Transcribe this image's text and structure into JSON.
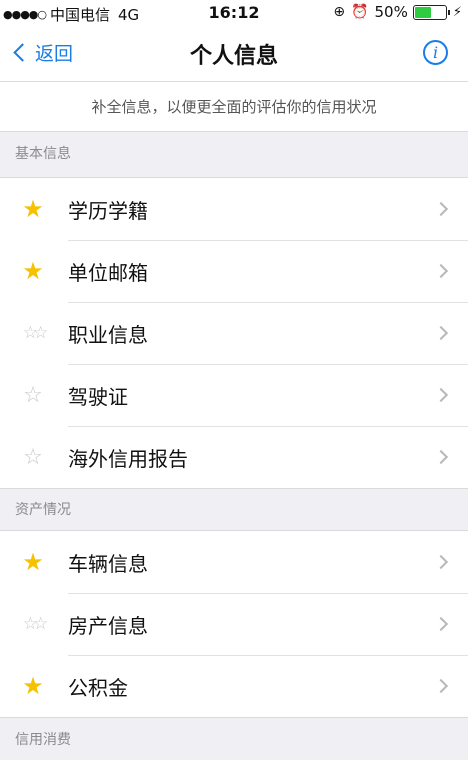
{
  "status_bar": {
    "signal": "●●●●○",
    "carrier": "中国电信",
    "network": "4G",
    "time": "16:12",
    "battery": "50%"
  },
  "nav": {
    "back_label": "返回",
    "title": "个人信息"
  },
  "hint": "补全信息，以便更全面的评估你的信用状况",
  "sections": [
    {
      "title": "基本信息",
      "items": [
        {
          "label": "学历学籍",
          "star": "full"
        },
        {
          "label": "单位邮箱",
          "star": "full"
        },
        {
          "label": "职业信息",
          "star": "half"
        },
        {
          "label": "驾驶证",
          "star": "empty"
        },
        {
          "label": "海外信用报告",
          "star": "empty"
        }
      ]
    },
    {
      "title": "资产情况",
      "items": [
        {
          "label": "车辆信息",
          "star": "full"
        },
        {
          "label": "房产信息",
          "star": "half"
        },
        {
          "label": "公积金",
          "star": "full"
        }
      ]
    },
    {
      "title": "信用消费",
      "items": []
    }
  ],
  "colors": {
    "accent": "#1a7ce6",
    "star_full": "#f6c100",
    "star_empty": "#c8c8cc",
    "background": "#efeff4"
  }
}
